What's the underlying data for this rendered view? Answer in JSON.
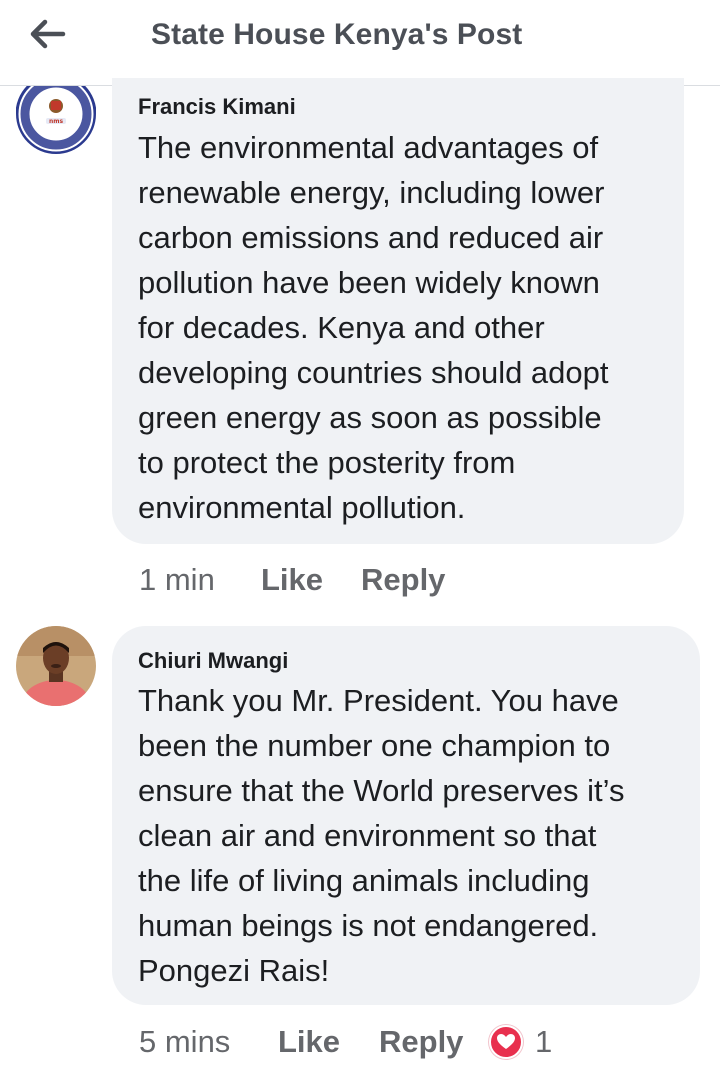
{
  "header": {
    "title": "State House Kenya's Post",
    "back_icon": "arrow-left-icon"
  },
  "comments": [
    {
      "author": "Francis Kimani",
      "avatar_icon": "nairobi-metropolitan-services-logo",
      "text": "The environmental advantages of\nrenewable energy, including lower\ncarbon emissions and reduced air\npollution have been widely known\nfor decades. Kenya and other\ndeveloping countries should adopt\ngreen energy as soon as possible\nto protect the posterity from\nenvironmental pollution.",
      "time": "1 min",
      "like_label": "Like",
      "reply_label": "Reply"
    },
    {
      "author": "Chiuri Mwangi",
      "avatar_icon": "profile-photo",
      "text": "Thank you Mr. President. You have\nbeen the number one champion to\nensure that the World preserves it’s\nclean air and environment so that\nthe life of living animals including\nhuman beings is not endangered.\nPongezi Rais!",
      "time": "5 mins",
      "like_label": "Like",
      "reply_label": "Reply",
      "reaction_icon": "heart-icon",
      "reaction_count": "1",
      "reaction_color": "#e8304e"
    }
  ],
  "colors": {
    "bubble": "#f0f2f5",
    "meta_text": "#65676b",
    "title_text": "#4b4f56"
  }
}
